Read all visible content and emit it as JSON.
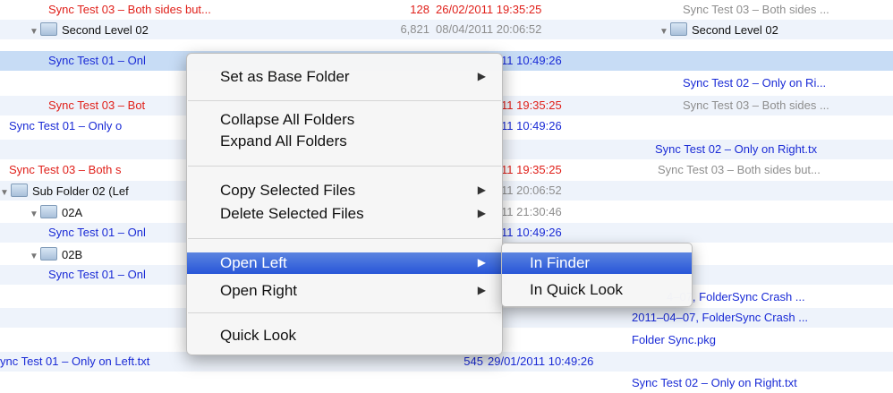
{
  "rows": [
    {
      "left": "Sync Test 03 – Both sides but...",
      "size": "128",
      "date": "26/02/2011 19:35:25",
      "right": "Sync Test 03 – Both sides ..."
    },
    {
      "left": "Second Level 02",
      "size": "6,821",
      "date": "08/04/2011 20:06:52",
      "right": "Second Level 02"
    },
    {
      "left": "Sync Test 01 – Onl",
      "date": "11 10:49:26"
    },
    {
      "right": "Sync Test 02 – Only on Ri..."
    },
    {
      "left": "Sync Test 03 – Bot",
      "date": "11 19:35:25",
      "right": "Sync Test 03 – Both sides ..."
    },
    {
      "left": "Sync Test 01 – Only o",
      "date": "11 10:49:26"
    },
    {
      "right": "Sync Test 02 – Only on Right.tx"
    },
    {
      "left": "Sync Test 03 – Both s",
      "date": "11 19:35:25",
      "right": "Sync Test 03 – Both sides but..."
    },
    {
      "left": "Sub Folder 02 (Lef",
      "date": "11 20:06:52"
    },
    {
      "left": "02A",
      "date": "11 21:30:46"
    },
    {
      "left": "Sync Test 01 – Onl",
      "date": "11 10:49:26"
    },
    {
      "left": "02B"
    },
    {
      "left": "Sync Test 01 – Onl"
    },
    {
      "right": "4–07, FolderSync Crash ..."
    },
    {
      "right": "2011–04–07, FolderSync Crash ..."
    },
    {
      "right": "Folder Sync.pkg"
    },
    {
      "left": "ync Test 01 – Only on Left.txt",
      "size": "545",
      "date": "29/01/2011 10:49:26"
    },
    {
      "right": "Sync Test 02 – Only on Right.txt"
    }
  ],
  "menu": {
    "set_base": "Set as Base Folder",
    "collapse_all": "Collapse All Folders",
    "expand_all": "Expand All Folders",
    "copy_selected": "Copy Selected Files",
    "delete_selected": "Delete Selected Files",
    "open_left": "Open Left",
    "open_right": "Open Right",
    "quick_look": "Quick Look",
    "arrow": "▶"
  },
  "submenu": {
    "in_finder": "In Finder",
    "in_quick_look": "In Quick Look"
  },
  "icons": {
    "disclosure_open": "▼",
    "folder": "folder-icon"
  },
  "colors": {
    "red_text": "#e0201a",
    "blue_text": "#1a2bd6",
    "selection": "#c7dcf5",
    "menu_highlight": "#2856d8"
  }
}
